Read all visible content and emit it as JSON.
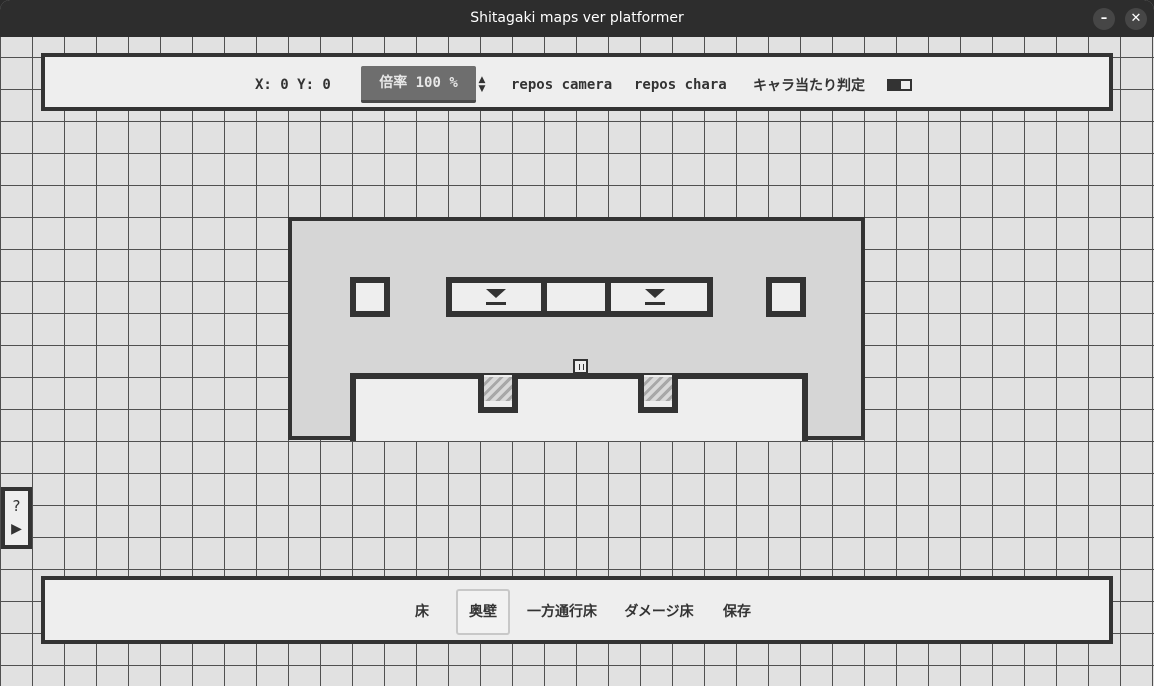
{
  "window": {
    "title": "Shitagaki maps ver platformer",
    "minimize_icon": "minimize-icon",
    "close_icon": "close-icon",
    "minimize_glyph": "–",
    "close_glyph": "✕"
  },
  "toolbar": {
    "coords": "X: 0 Y: 0",
    "zoom_label": "倍率 100 %",
    "zoom_spin_up": "▲",
    "zoom_spin_down": "▼",
    "repos_camera": "repos camera",
    "repos_chara": "repos chara",
    "hitbox_label": "キャラ当たり判定",
    "hitbox_toggle_on": false
  },
  "help": {
    "question": "?",
    "play": "▶"
  },
  "bottom_toolbar": {
    "tools": [
      {
        "label": "床",
        "selected": false
      },
      {
        "label": "奥壁",
        "selected": true
      },
      {
        "label": "一方通行床",
        "selected": false
      },
      {
        "label": "ダメージ床",
        "selected": false
      },
      {
        "label": "保存",
        "selected": false
      }
    ]
  },
  "colors": {
    "titlebar": "#2d2d2d",
    "panel_bg": "#eeeeee",
    "border": "#333333",
    "grid_bg": "#e1e1e1",
    "map_bg": "#d6d6d6",
    "zoom_button": "#6e6e6e"
  },
  "icons": {
    "spike": "spike-down-icon",
    "spawn": "spawn-marker-icon",
    "damage": "damage-hatch-icon"
  }
}
